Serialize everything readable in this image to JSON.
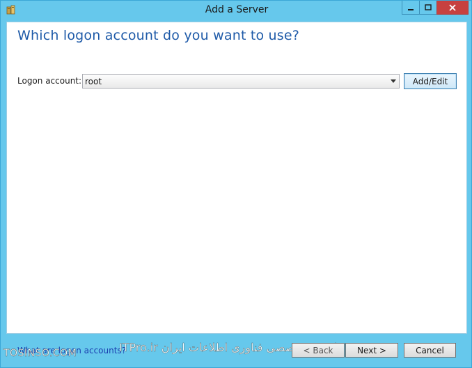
{
  "window": {
    "title": "Add a Server",
    "controls": {
      "minimize_icon": "minimize-icon",
      "maximize_icon": "maximize-icon",
      "close_icon": "close-icon"
    }
  },
  "main": {
    "heading": "Which logon account do you want to use?",
    "logon_label": "Logon account:",
    "logon_value": "root",
    "add_edit_label": "Add/Edit"
  },
  "footer": {
    "help_link": "What are logon accounts?",
    "back_label": "< Back",
    "next_label": "Next >",
    "cancel_label": "Cancel"
  },
  "watermark": {
    "left": "TOSINSO.COM",
    "middle": "انجمن تخصصی فناوری اطلاعات ایران ITPro.ir"
  },
  "colors": {
    "frame": "#66c8ec",
    "heading": "#1e5aa8",
    "close": "#c7413f",
    "link": "#1b3fb0"
  }
}
